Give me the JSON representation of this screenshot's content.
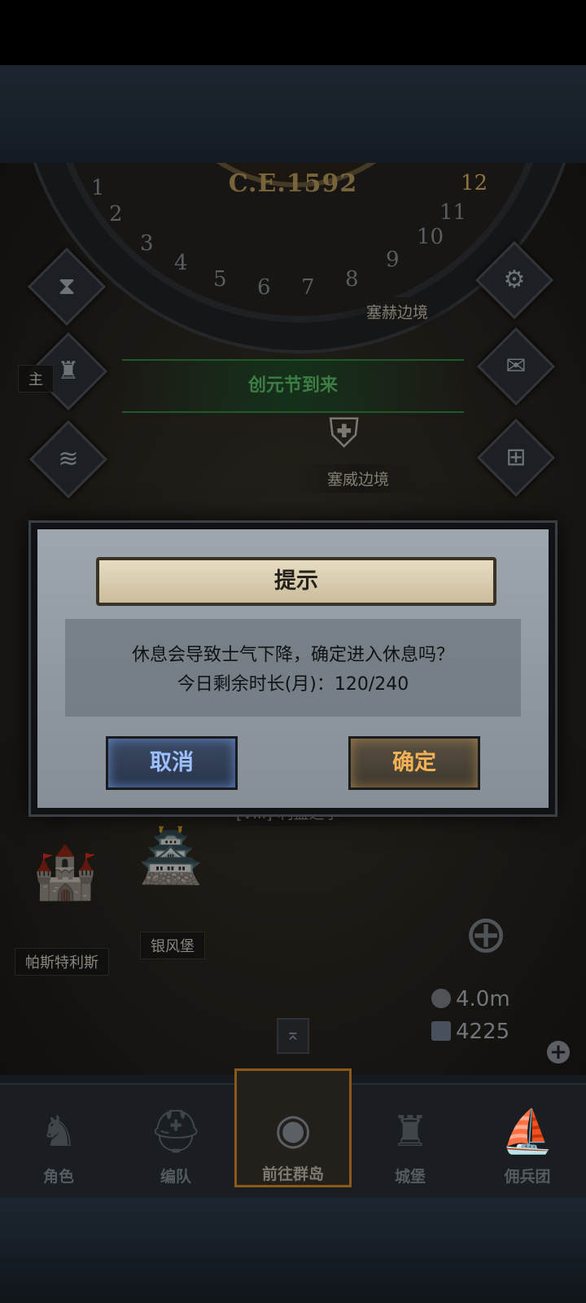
{
  "calendar": {
    "year": "C.E.1592",
    "months": [
      "1",
      "2",
      "3",
      "4",
      "5",
      "6",
      "7",
      "8",
      "9",
      "10",
      "11",
      "12"
    ]
  },
  "map": {
    "regions": [
      "塞赫边境",
      "塞威边境"
    ],
    "event_banner": "创元节到来",
    "quest_label": "[VIII]-利益之争",
    "castles": [
      "帕斯特利斯",
      "银风堡"
    ],
    "partial_label": "主"
  },
  "resources": {
    "silver": "4.0m",
    "crystal": "4225"
  },
  "tabs": [
    {
      "label": "角色",
      "icon": "knight-icon"
    },
    {
      "label": "编队",
      "icon": "helmet-icon"
    },
    {
      "label": "前往群岛",
      "icon": "globe-icon",
      "active": true
    },
    {
      "label": "城堡",
      "icon": "castle-icon"
    },
    {
      "label": "佣兵团",
      "icon": "ship-icon"
    }
  ],
  "dialog": {
    "title": "提示",
    "message": "休息会导致士气下降，确定进入休息吗？",
    "remaining": "今日剩余时长(月)：120/240",
    "cancel_label": "取消",
    "confirm_label": "确定"
  },
  "colors": {
    "cancel_text": "#9cc0ff",
    "confirm_text": "#f1b255",
    "event_green": "#5fbf6a",
    "year_gold": "#b89a5a"
  }
}
